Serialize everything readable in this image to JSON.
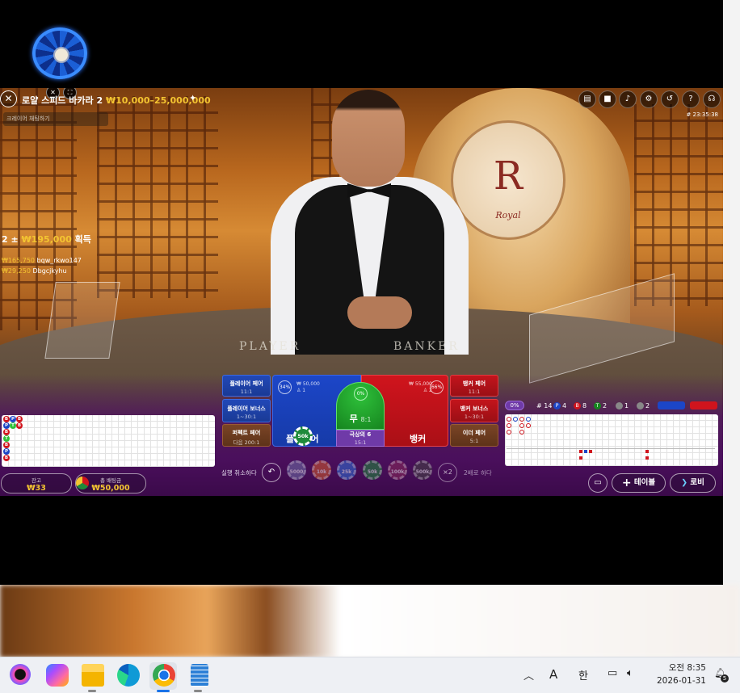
{
  "game": {
    "title_main": "로얄 스피드 바카라 2",
    "title_limit": "₩10,000–25,000,000",
    "chat_placeholder": "크레이어 채팅하기",
    "clock": "# 23:35:38",
    "table_left": "PLAYER",
    "table_right": "BANKER",
    "logo_letter": "R",
    "logo_word": "Royal"
  },
  "winners": {
    "headline_prefix": "2 ± ",
    "headline_amount": "₩195,000",
    "headline_suffix": " 획득",
    "list": [
      {
        "amount": "₩165,750",
        "name": "bqw_rkwo147"
      },
      {
        "amount": "₩29,250",
        "name": "Dbgcjkyhu"
      }
    ]
  },
  "bets": {
    "player_pair": {
      "label": "플레이어 페어",
      "odds": "11:1"
    },
    "player_bonus": {
      "label": "플레이어 보너스",
      "odds": "1~30:1"
    },
    "perfect_pair": {
      "label": "퍼펙트 페어",
      "odds": "다음 200:1"
    },
    "banker_pair": {
      "label": "뱅커 페어",
      "odds": "11:1"
    },
    "banker_bonus": {
      "label": "뱅커 보너스",
      "odds": "1~30:1"
    },
    "either_pair": {
      "label": "이더 페어",
      "odds": "5:1"
    },
    "player": {
      "label": "플레이어",
      "stake": "₩ 50,000",
      "count": "1",
      "pct": "34%"
    },
    "banker": {
      "label": "뱅커",
      "stake": "₩ 55,000",
      "count": "2",
      "pct": "66%"
    },
    "tie": {
      "label": "무",
      "odds": "8:1",
      "pct": "0%"
    },
    "lucky6": {
      "label": "극상의 6",
      "odds": "15:1"
    },
    "player_chip": "50k"
  },
  "roads": {
    "bead": [
      [
        "B",
        "P",
        "B"
      ],
      [
        "P",
        "T",
        "B"
      ],
      [
        "B",
        "",
        ""
      ],
      [
        "T",
        "",
        ""
      ],
      [
        "B",
        "",
        ""
      ],
      [
        "P",
        "",
        ""
      ],
      [
        "B",
        "",
        ""
      ]
    ],
    "stats": {
      "shoe": "0%",
      "games": "14",
      "player": "4",
      "banker": "8",
      "tie": "2",
      "player_pair": "1",
      "banker_pair": "2"
    }
  },
  "controls": {
    "balance_label": "잔고",
    "balance": "₩33",
    "total_label": "총 배팅금",
    "total": "₩50,000",
    "undo_label": "실행 취소하다",
    "chips": [
      "5000",
      "10k",
      "25k",
      "50k",
      "100k",
      "500k"
    ],
    "double_label": "2배로 하다",
    "double_btn": "×2",
    "tables_btn": "테이블",
    "lobby_btn": "로비"
  },
  "taskbar": {
    "time": "오전 8:35",
    "date": "2026-01-31",
    "ime_a": "A",
    "ime_han": "한",
    "notif_count": "5"
  },
  "colors": {
    "player": "#1c46c8",
    "banker": "#d0141d",
    "tie": "#2ec03a",
    "gold": "#f3c431",
    "purple": "#4a0f5c"
  }
}
